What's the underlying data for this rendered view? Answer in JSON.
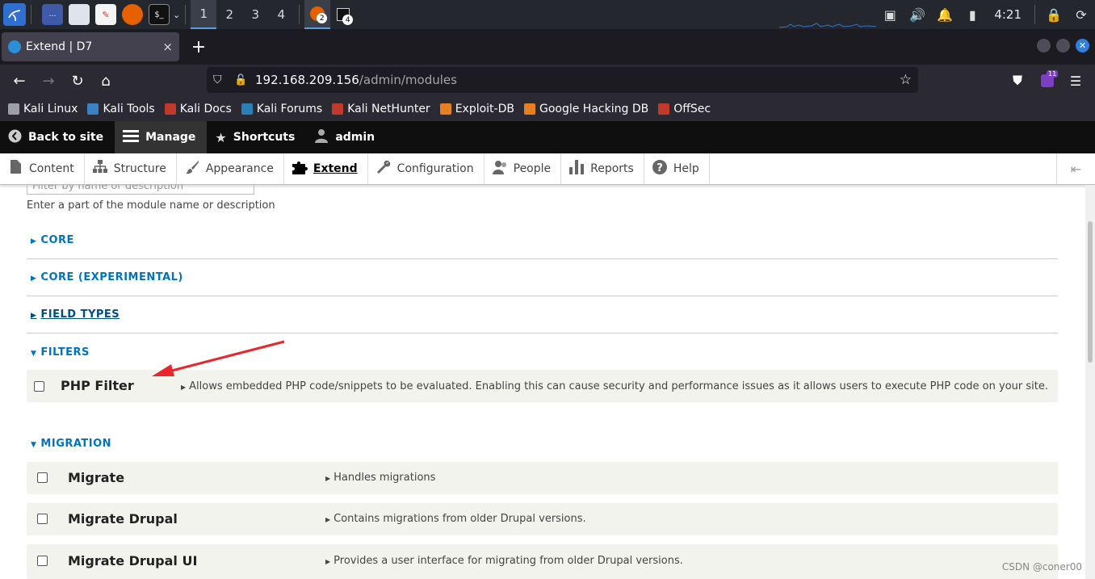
{
  "taskbar": {
    "workspaces": [
      "1",
      "2",
      "3",
      "4"
    ],
    "active_workspace": "1",
    "window_badges": [
      "2",
      "4"
    ],
    "clock": "4:21"
  },
  "browser": {
    "tab_title": "Extend | D7",
    "tab_close": "×",
    "new_tab": "+",
    "url_host": "192.168.209.156",
    "url_path": "/admin/modules",
    "extension_badge": "11",
    "bookmarks": [
      {
        "label": "Kali Linux",
        "color": "#9aa0a6"
      },
      {
        "label": "Kali Tools",
        "color": "#3b82c4"
      },
      {
        "label": "Kali Docs",
        "color": "#c0392b"
      },
      {
        "label": "Kali Forums",
        "color": "#2980b9"
      },
      {
        "label": "Kali NetHunter",
        "color": "#c0392b"
      },
      {
        "label": "Exploit-DB",
        "color": "#e67e22"
      },
      {
        "label": "Google Hacking DB",
        "color": "#e67e22"
      },
      {
        "label": "OffSec",
        "color": "#c0392b"
      }
    ]
  },
  "drupal_toolbar": {
    "back_to_site": "Back to site",
    "manage": "Manage",
    "shortcuts": "Shortcuts",
    "user": "admin"
  },
  "tray": {
    "items": [
      {
        "label": "Content",
        "icon": "file-icon"
      },
      {
        "label": "Structure",
        "icon": "sitemap-icon"
      },
      {
        "label": "Appearance",
        "icon": "brush-icon"
      },
      {
        "label": "Extend",
        "icon": "puzzle-icon"
      },
      {
        "label": "Configuration",
        "icon": "wrench-icon"
      },
      {
        "label": "People",
        "icon": "people-icon"
      },
      {
        "label": "Reports",
        "icon": "bar-chart-icon"
      },
      {
        "label": "Help",
        "icon": "help-icon"
      }
    ],
    "active": "Extend"
  },
  "filter": {
    "placeholder": "Filter by name or description",
    "description": "Enter a part of the module name or description"
  },
  "packages": {
    "core": "CORE",
    "core_experimental": "CORE (EXPERIMENTAL)",
    "field_types": "FIELD TYPES",
    "filters": "FILTERS",
    "migration": "MIGRATION"
  },
  "modules": {
    "php_filter": {
      "name": "PHP Filter",
      "description": "Allows embedded PHP code/snippets to be evaluated. Enabling this can cause security and performance issues as it allows users to execute PHP code on your site."
    },
    "migrate": {
      "name": "Migrate",
      "description": "Handles migrations"
    },
    "migrate_drupal": {
      "name": "Migrate Drupal",
      "description": "Contains migrations from older Drupal versions."
    },
    "migrate_drupal_ui": {
      "name": "Migrate Drupal UI",
      "description": "Provides a user interface for migrating from older Drupal versions."
    }
  },
  "annotation": {
    "arrow_color": "#e8262b"
  },
  "watermark": "CSDN @coner00"
}
